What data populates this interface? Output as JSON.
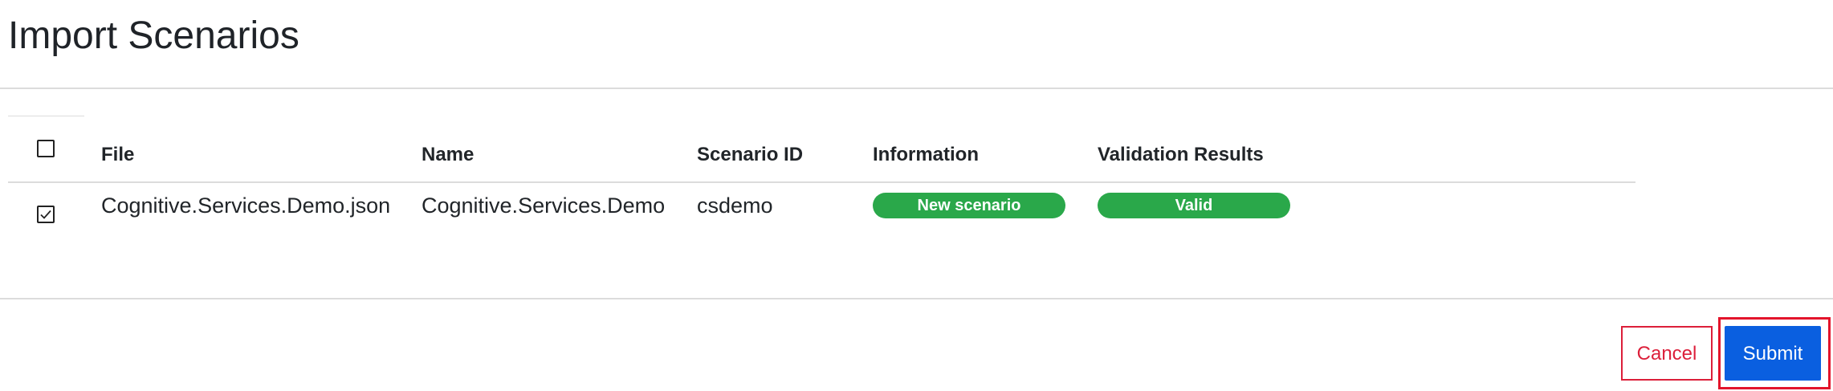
{
  "page": {
    "title": "Import Scenarios"
  },
  "table": {
    "columns": {
      "file": "File",
      "name": "Name",
      "scenario_id": "Scenario ID",
      "information": "Information",
      "validation": "Validation Results"
    },
    "header_checkbox_checked": false,
    "rows": [
      {
        "checked": true,
        "file": "Cognitive.Services.Demo.json",
        "name": "Cognitive.Services.Demo",
        "scenario_id": "csdemo",
        "information": "New scenario",
        "validation": "Valid"
      }
    ]
  },
  "colors": {
    "badge_green": "#2aa84a",
    "primary_blue": "#0a5fe0",
    "danger_red": "#dc1f3a"
  },
  "actions": {
    "cancel_label": "Cancel",
    "submit_label": "Submit"
  }
}
